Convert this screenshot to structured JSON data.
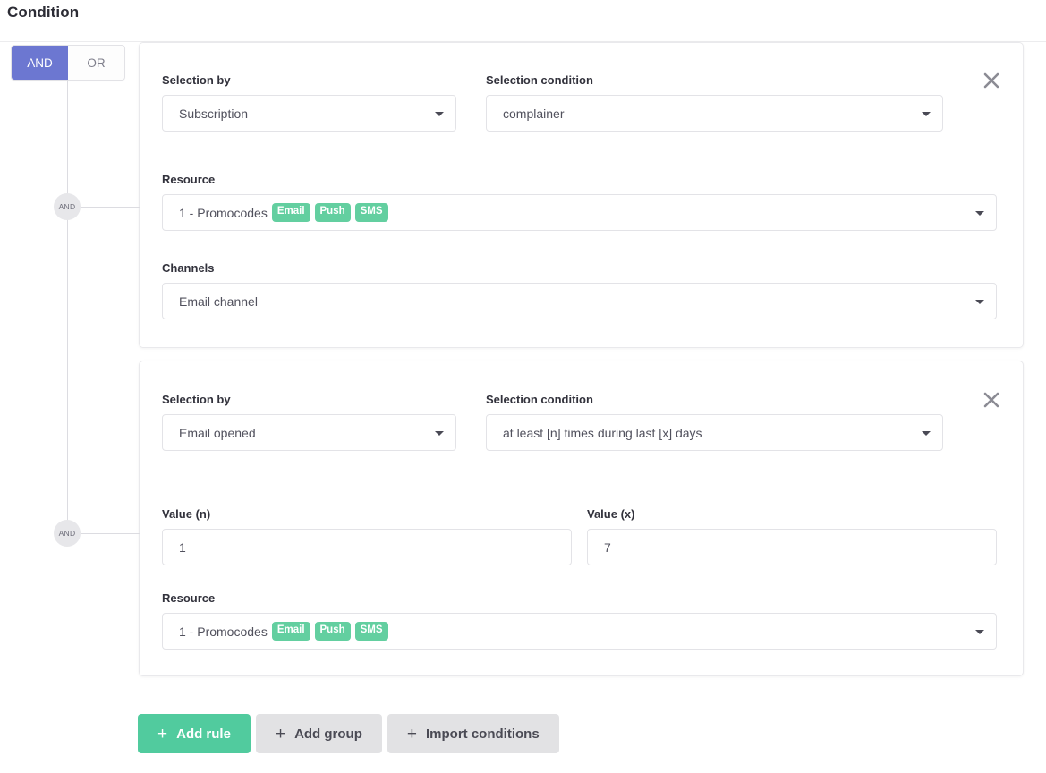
{
  "page": {
    "title": "Condition"
  },
  "logic_toggle": {
    "options": [
      {
        "label": "AND",
        "active": true
      },
      {
        "label": "OR",
        "active": false
      }
    ],
    "active_color": "#6c77d1"
  },
  "tree": {
    "nodes": [
      {
        "label": "AND"
      },
      {
        "label": "AND"
      }
    ]
  },
  "rules": [
    {
      "selection_by": {
        "label": "Selection by",
        "value": "Subscription"
      },
      "selection_condition": {
        "label": "Selection condition",
        "value": "complainer"
      },
      "resource": {
        "label": "Resource",
        "value": "1 - Promocodes",
        "badges": [
          "Email",
          "Push",
          "SMS"
        ]
      },
      "channels": {
        "label": "Channels",
        "value": "Email channel"
      },
      "close_icon": "close-icon"
    },
    {
      "selection_by": {
        "label": "Selection by",
        "value": "Email opened"
      },
      "selection_condition": {
        "label": "Selection condition",
        "value": "at least [n] times during last [x] days"
      },
      "value_n": {
        "label": "Value (n)",
        "value": "1"
      },
      "value_x": {
        "label": "Value (x)",
        "value": "7"
      },
      "resource": {
        "label": "Resource",
        "value": "1 - Promocodes",
        "badges": [
          "Email",
          "Push",
          "SMS"
        ]
      },
      "close_icon": "close-icon"
    }
  ],
  "footer": {
    "buttons": [
      {
        "icon": "plus-icon",
        "label": "Add rule",
        "style": "primary"
      },
      {
        "icon": "plus-icon",
        "label": "Add group",
        "style": "secondary"
      },
      {
        "icon": "plus-icon",
        "label": "Import conditions",
        "style": "secondary"
      }
    ]
  },
  "colors": {
    "badge_green": "#63cfa0",
    "primary_button": "#51cb9e",
    "toggle_active": "#6c77d1"
  }
}
